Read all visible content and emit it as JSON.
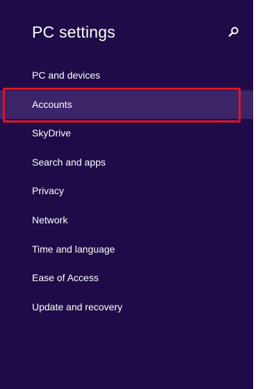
{
  "header": {
    "title": "PC settings",
    "search_icon": "search-icon"
  },
  "nav": {
    "items": [
      {
        "label": "PC and devices",
        "selected": false
      },
      {
        "label": "Accounts",
        "selected": true
      },
      {
        "label": "SkyDrive",
        "selected": false
      },
      {
        "label": "Search and apps",
        "selected": false
      },
      {
        "label": "Privacy",
        "selected": false
      },
      {
        "label": "Network",
        "selected": false
      },
      {
        "label": "Time and language",
        "selected": false
      },
      {
        "label": "Ease of Access",
        "selected": false
      },
      {
        "label": "Update and recovery",
        "selected": false
      }
    ]
  },
  "colors": {
    "background": "#1f0b47",
    "selected_item": "#3b2568",
    "annotation": "#e3141c",
    "text": "#ffffff"
  }
}
